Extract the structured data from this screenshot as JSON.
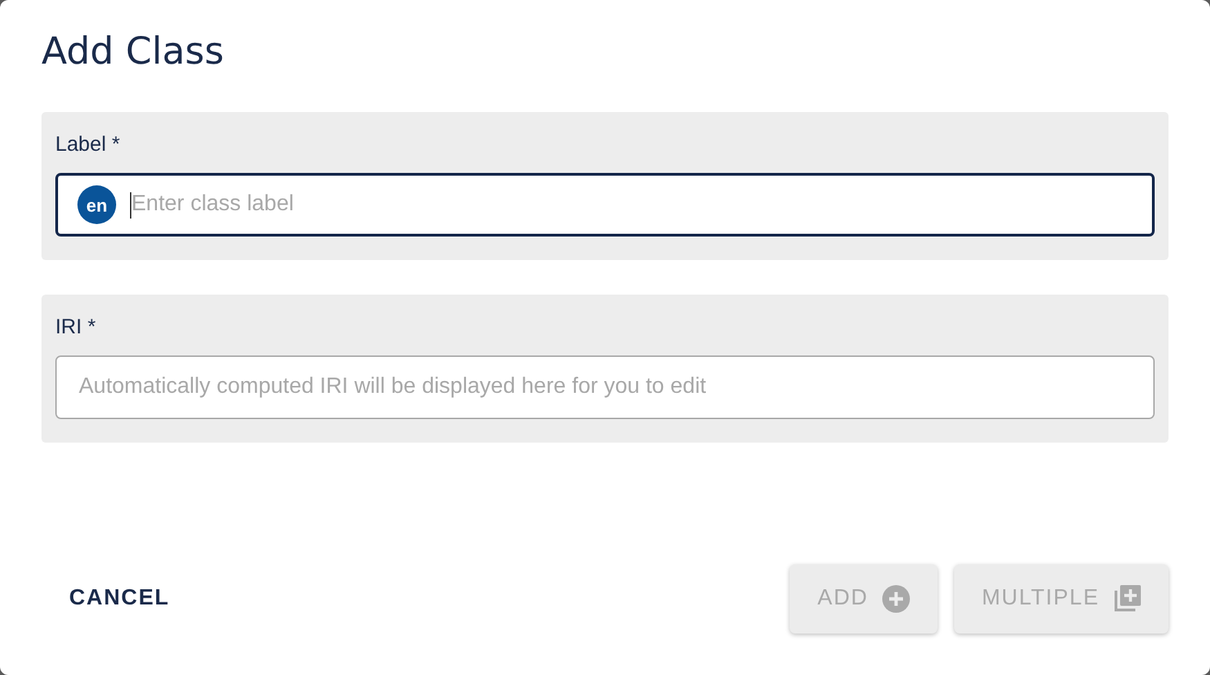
{
  "dialog": {
    "title": "Add Class",
    "fields": [
      {
        "label": "Label *",
        "language": "en",
        "placeholder": "Enter class label",
        "focused": true
      },
      {
        "label": "IRI *",
        "placeholder": "Automatically computed IRI will be displayed here for you to edit",
        "focused": false
      }
    ],
    "actions": [
      {
        "label": "CANCEL",
        "kind": "text",
        "disabled": false
      },
      {
        "label": "ADD",
        "kind": "raised",
        "disabled": true
      },
      {
        "label": "MULTIPLE",
        "kind": "raised",
        "disabled": true
      }
    ]
  }
}
